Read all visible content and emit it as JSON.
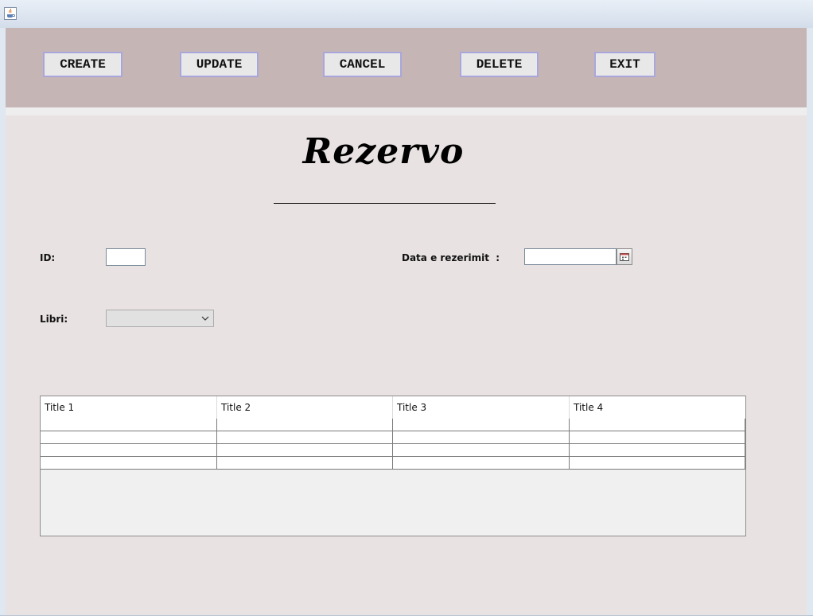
{
  "window": {
    "app_icon": "java-cup-icon"
  },
  "toolbar": {
    "create_label": "CREATE",
    "update_label": "UPDATE",
    "cancel_label": "CANCEL",
    "delete_label": "DELETE",
    "exit_label": "EXIT"
  },
  "form": {
    "heading": "Rezervo",
    "id_label": "ID:",
    "id_value": "",
    "date_label": "Data e rezerimit  :",
    "date_value": "",
    "date_icon": "calendar-icon",
    "libri_label": "Libri:",
    "libri_selected": ""
  },
  "table": {
    "columns": [
      "Title 1",
      "Title 2",
      "Title 3",
      "Title 4"
    ],
    "rows": [
      [
        "",
        "",
        "",
        ""
      ],
      [
        "",
        "",
        "",
        ""
      ],
      [
        "",
        "",
        "",
        ""
      ],
      [
        "",
        "",
        "",
        ""
      ]
    ]
  },
  "colors": {
    "toolbar_bg": "#c5b6b5",
    "content_bg": "#e9e2e2",
    "button_border": "#a9a6dc"
  }
}
